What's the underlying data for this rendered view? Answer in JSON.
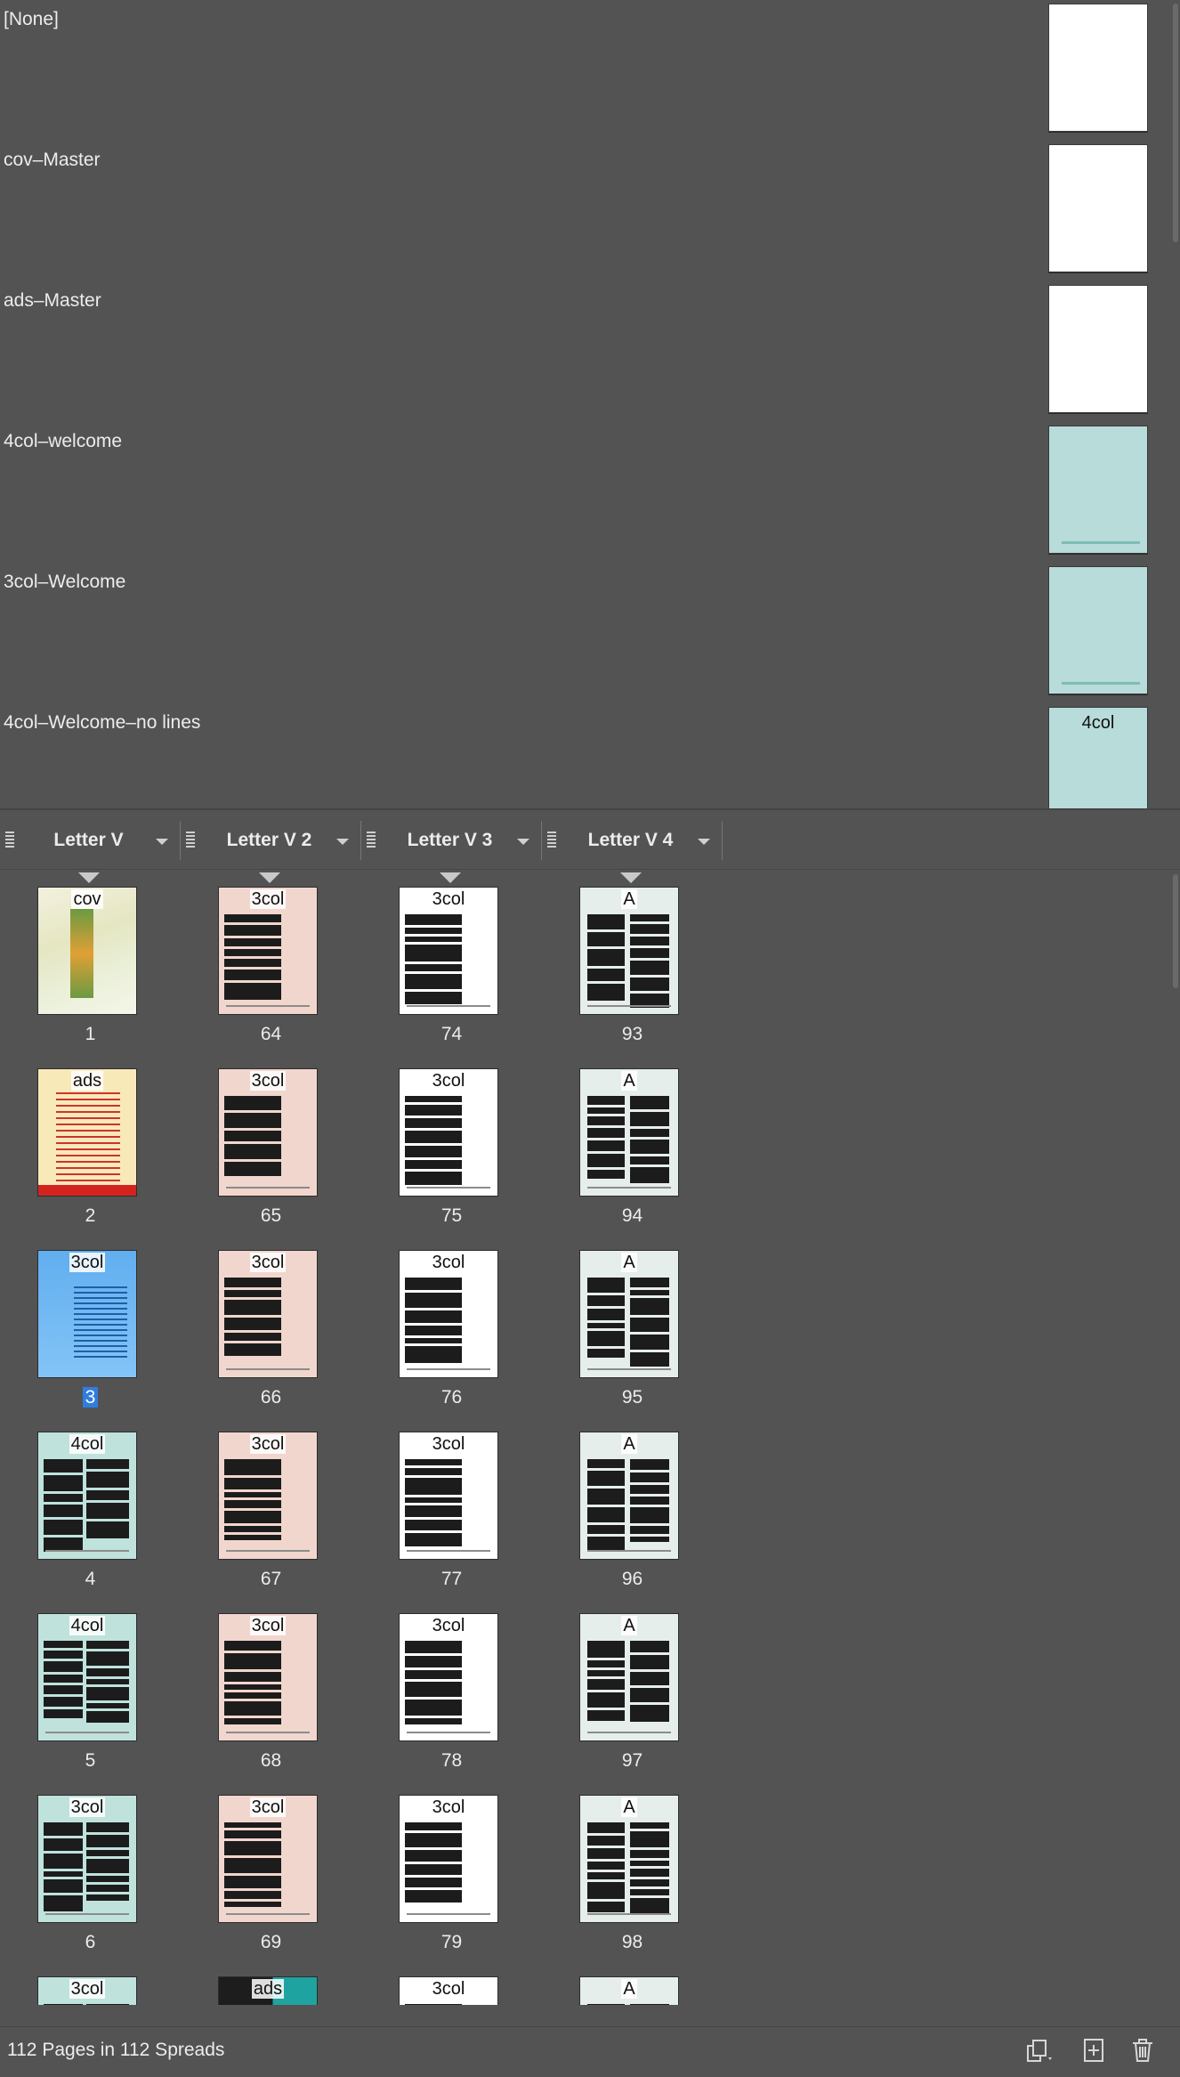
{
  "masters": [
    {
      "label": "[None]",
      "thumb_style": "white",
      "prefix": ""
    },
    {
      "label": "cov–Master",
      "thumb_style": "white",
      "prefix": ""
    },
    {
      "label": "ads–Master",
      "thumb_style": "white",
      "prefix": ""
    },
    {
      "label": "4col–welcome",
      "thumb_style": "teal",
      "prefix": ""
    },
    {
      "label": "3col–Welcome",
      "thumb_style": "teal",
      "prefix": ""
    },
    {
      "label": "4col–Welcome–no lines",
      "thumb_style": "teal",
      "prefix": "4col"
    }
  ],
  "page_sizes": [
    "Letter V",
    "Letter V 2",
    "Letter V 3",
    "Letter V 4"
  ],
  "columns": [
    [
      {
        "num": "1",
        "prefix": "cov",
        "style": "cov",
        "selected": false,
        "start": true
      },
      {
        "num": "2",
        "prefix": "ads",
        "style": "ads",
        "selected": false,
        "start": false
      },
      {
        "num": "3",
        "prefix": "3col",
        "style": "blue",
        "selected": true,
        "start": false
      },
      {
        "num": "4",
        "prefix": "4col",
        "style": "teal",
        "selected": false,
        "start": false
      },
      {
        "num": "5",
        "prefix": "4col",
        "style": "teal",
        "selected": false,
        "start": false
      },
      {
        "num": "6",
        "prefix": "3col",
        "style": "teal",
        "selected": false,
        "start": false
      },
      {
        "num": "",
        "prefix": "3col",
        "style": "teal",
        "selected": false,
        "start": false
      }
    ],
    [
      {
        "num": "64",
        "prefix": "3col",
        "style": "pink",
        "selected": false,
        "start": true
      },
      {
        "num": "65",
        "prefix": "3col",
        "style": "pink",
        "selected": false,
        "start": false
      },
      {
        "num": "66",
        "prefix": "3col",
        "style": "pink",
        "selected": false,
        "start": false
      },
      {
        "num": "67",
        "prefix": "3col",
        "style": "pink",
        "selected": false,
        "start": false
      },
      {
        "num": "68",
        "prefix": "3col",
        "style": "pink",
        "selected": false,
        "start": false
      },
      {
        "num": "69",
        "prefix": "3col",
        "style": "pink",
        "selected": false,
        "start": false
      },
      {
        "num": "",
        "prefix": "ads",
        "style": "mix",
        "selected": false,
        "start": false
      }
    ],
    [
      {
        "num": "74",
        "prefix": "3col",
        "style": "white",
        "selected": false,
        "start": true
      },
      {
        "num": "75",
        "prefix": "3col",
        "style": "white",
        "selected": false,
        "start": false
      },
      {
        "num": "76",
        "prefix": "3col",
        "style": "white",
        "selected": false,
        "start": false
      },
      {
        "num": "77",
        "prefix": "3col",
        "style": "white",
        "selected": false,
        "start": false
      },
      {
        "num": "78",
        "prefix": "3col",
        "style": "white",
        "selected": false,
        "start": false
      },
      {
        "num": "79",
        "prefix": "3col",
        "style": "white",
        "selected": false,
        "start": false
      },
      {
        "num": "",
        "prefix": "3col",
        "style": "white",
        "selected": false,
        "start": false
      }
    ],
    [
      {
        "num": "93",
        "prefix": "A",
        "style": "grey",
        "selected": false,
        "start": true
      },
      {
        "num": "94",
        "prefix": "A",
        "style": "grey",
        "selected": false,
        "start": false
      },
      {
        "num": "95",
        "prefix": "A",
        "style": "grey",
        "selected": false,
        "start": false
      },
      {
        "num": "96",
        "prefix": "A",
        "style": "grey",
        "selected": false,
        "start": false
      },
      {
        "num": "97",
        "prefix": "A",
        "style": "grey",
        "selected": false,
        "start": false
      },
      {
        "num": "98",
        "prefix": "A",
        "style": "grey",
        "selected": false,
        "start": false
      },
      {
        "num": "",
        "prefix": "A",
        "style": "grey",
        "selected": false,
        "start": false
      }
    ]
  ],
  "footer": {
    "status": "112 Pages in 112 Spreads",
    "icons": [
      "edit-page-size-icon",
      "new-page-icon",
      "delete-page-icon"
    ]
  },
  "colors": {
    "panel_bg": "#535353",
    "selection": "#2f7de1",
    "teal_master": "#b7dcd9"
  }
}
